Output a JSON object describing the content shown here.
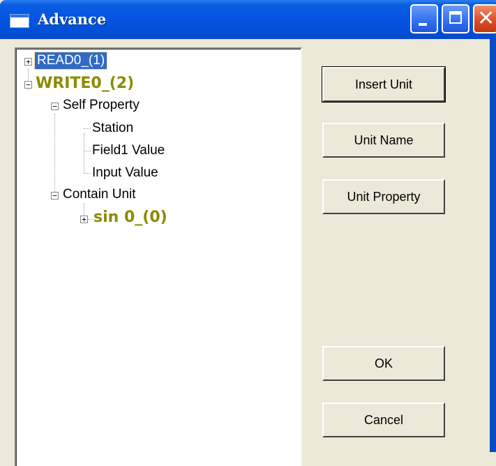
{
  "window": {
    "title": "Advance"
  },
  "tree": {
    "nodes": [
      {
        "label": "READ0_(1)",
        "expander": "+",
        "selected": true
      },
      {
        "label": "WRITE0_(2)",
        "expander": "−",
        "bold": true
      },
      {
        "label": "Self Property",
        "expander": "−"
      },
      {
        "label": "Station"
      },
      {
        "label": "Field1 Value"
      },
      {
        "label": "Input Value"
      },
      {
        "label": "Contain Unit",
        "expander": "−"
      },
      {
        "label": "sin 0_(0)",
        "expander": "+",
        "bold": true
      }
    ]
  },
  "buttons": {
    "insert_unit": "Insert Unit",
    "unit_name": "Unit Name",
    "unit_property": "Unit Property",
    "ok": "OK",
    "cancel": "Cancel"
  },
  "colors": {
    "titlebar": "#0554e3",
    "selection": "#316AC5",
    "bold_node": "#8b8b00",
    "dialog_bg": "#ECE9D8"
  }
}
